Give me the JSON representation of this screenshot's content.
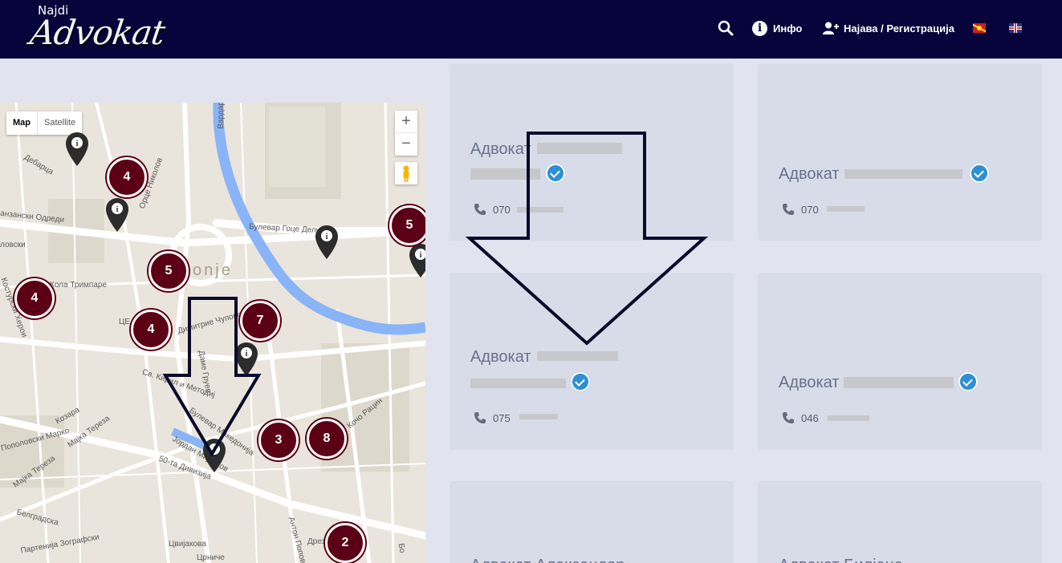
{
  "header": {
    "logo_small": "Najdi",
    "logo_big": "Advokat",
    "info_label": "Инфо",
    "login_label": "Најава / Регистрација",
    "languages": [
      "mk",
      "en"
    ]
  },
  "map": {
    "type_buttons": [
      "Map",
      "Satellite"
    ],
    "zoom_in": "+",
    "zoom_out": "−",
    "city_label": "onje",
    "street_labels": [
      "Булевар Гоце Делчев",
      "Дебарца",
      "Орце Николов",
      "анзански Одреди",
      "ловски",
      "Кола Тримпаре",
      "Костурски Херои",
      "Димитрие Чуповски",
      "Даме Груев",
      "Св. Кирил и Методиј",
      "Козара",
      "Мајка Тереза",
      "Мајка Тереза",
      "Пополовски Марко",
      "Булевар Македонија",
      "Јордан Мијалков",
      "50-та Дивизија",
      "Белградска",
      "Партенија Зографски",
      "Кочо Рацин",
      "Антон Попов",
      "Цвијакова",
      "Црниче",
      "Дрез",
      "Вардар",
      "ЦЕ",
      "Бо"
    ],
    "clusters": [
      "4",
      "5",
      "4",
      "4",
      "7",
      "3",
      "8",
      "5",
      "2"
    ]
  },
  "cards": [
    {
      "title": "Адвокат",
      "phone_prefix": "070",
      "verified": true
    },
    {
      "title": "Адвокат",
      "phone_prefix": "070",
      "verified": true
    },
    {
      "title": "Адвокат",
      "phone_prefix": "075",
      "verified": true
    },
    {
      "title": "Адвокат",
      "phone_prefix": "046",
      "verified": true
    },
    {
      "title": "Адвокат Александар",
      "phone_prefix": "",
      "verified": false
    },
    {
      "title": "Адвокат Билјана",
      "phone_prefix": "",
      "verified": false
    }
  ],
  "colors": {
    "header_bg": "#06043a",
    "cluster": "#5c0016",
    "verified": "#2f8fd4",
    "page_bg": "#e1e4ef",
    "card_bg": "#d8dce8"
  }
}
